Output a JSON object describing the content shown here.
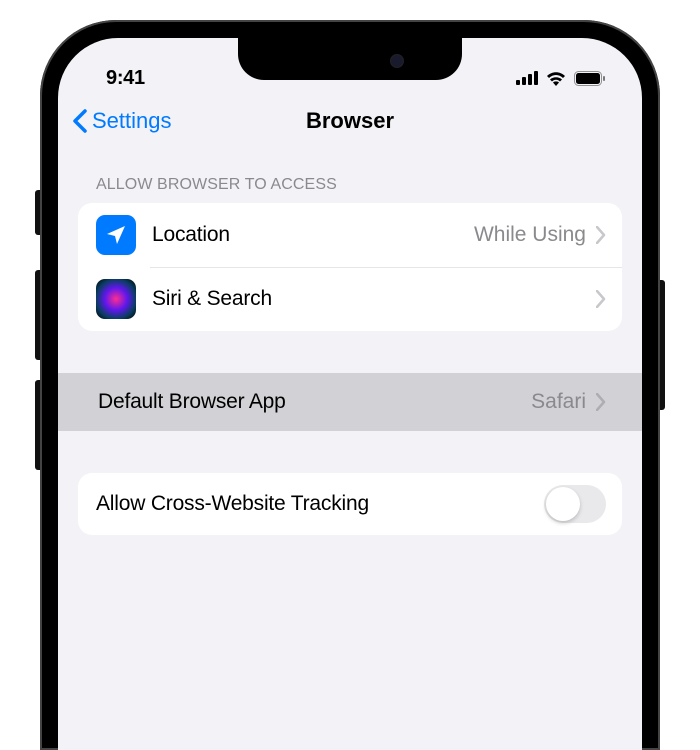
{
  "status": {
    "time": "9:41"
  },
  "nav": {
    "back_label": "Settings",
    "title": "Browser"
  },
  "section1": {
    "header": "Allow Browser to Access",
    "location": {
      "label": "Location",
      "value": "While Using"
    },
    "siri": {
      "label": "Siri & Search"
    }
  },
  "section2": {
    "default_browser": {
      "label": "Default Browser App",
      "value": "Safari"
    }
  },
  "section3": {
    "tracking": {
      "label": "Allow Cross-Website Tracking",
      "enabled": false
    }
  }
}
